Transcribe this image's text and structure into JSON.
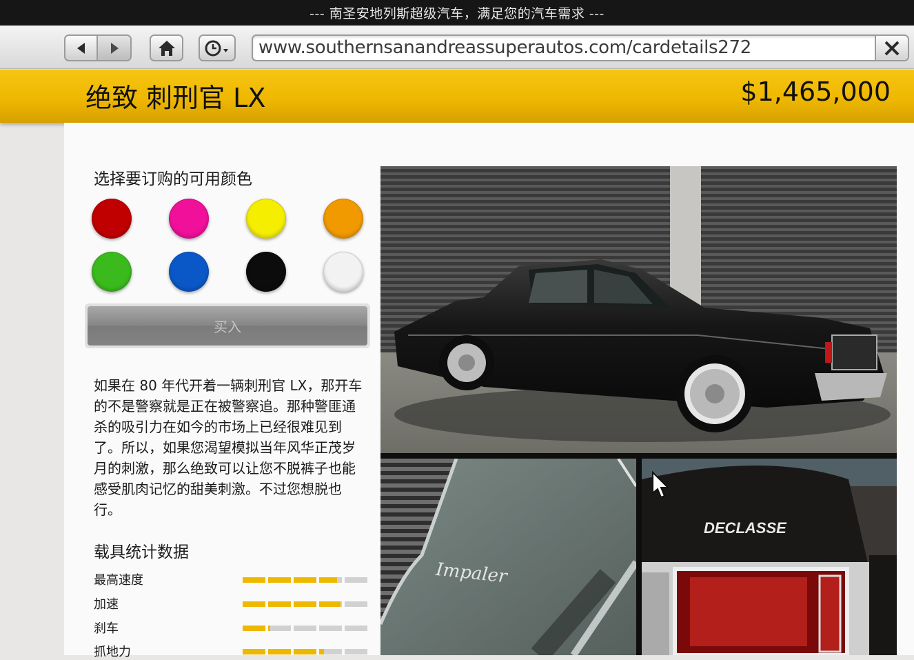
{
  "window": {
    "title": "--- 南圣安地列斯超级汽车，满足您的汽车需求 ---"
  },
  "browser": {
    "back_icon": "back-arrow-icon",
    "forward_icon": "forward-arrow-icon",
    "home_icon": "home-icon",
    "history_icon": "clock-history-icon",
    "url": "www.southernsanandreassuperautos.com/cardetails272",
    "clear_icon": "close-icon"
  },
  "header": {
    "car_name": "绝致 刺刑官 LX",
    "price": "$1,465,000",
    "accent": "#efb800"
  },
  "colors": {
    "heading": "选择要订购的可用颜色",
    "swatches": [
      "#c00000",
      "#f0109a",
      "#f5ee00",
      "#f19a00",
      "#3bba1e",
      "#0a58c8",
      "#0c0c0c",
      "#f2f2f2"
    ]
  },
  "buy": {
    "label": "买入"
  },
  "description": "如果在 80 年代开着一辆刺刑官 LX，那开车的不是警察就是正在被警察追。那种警匪通杀的吸引力在如今的市场上已经很难见到了。所以，如果您渴望模拟当年风华正茂岁月的刺激，那么绝致可以让您不脱裤子也能感受肌肉记忆的甜美刺激。不过您想脱也行。",
  "stats": {
    "heading": "载具统计数据",
    "items": [
      {
        "label": "最高速度",
        "value": 0.76
      },
      {
        "label": "加速",
        "value": 0.79
      },
      {
        "label": "刹车",
        "value": 0.22
      },
      {
        "label": "抓地力",
        "value": 0.64
      }
    ]
  },
  "photos": {
    "main": "sedan-in-garage-photo",
    "detail_left": "impaler-badge-photo",
    "detail_right": "declasse-taillight-photo",
    "badge_text": "Impaler",
    "brand_text": "DECLASSE"
  }
}
